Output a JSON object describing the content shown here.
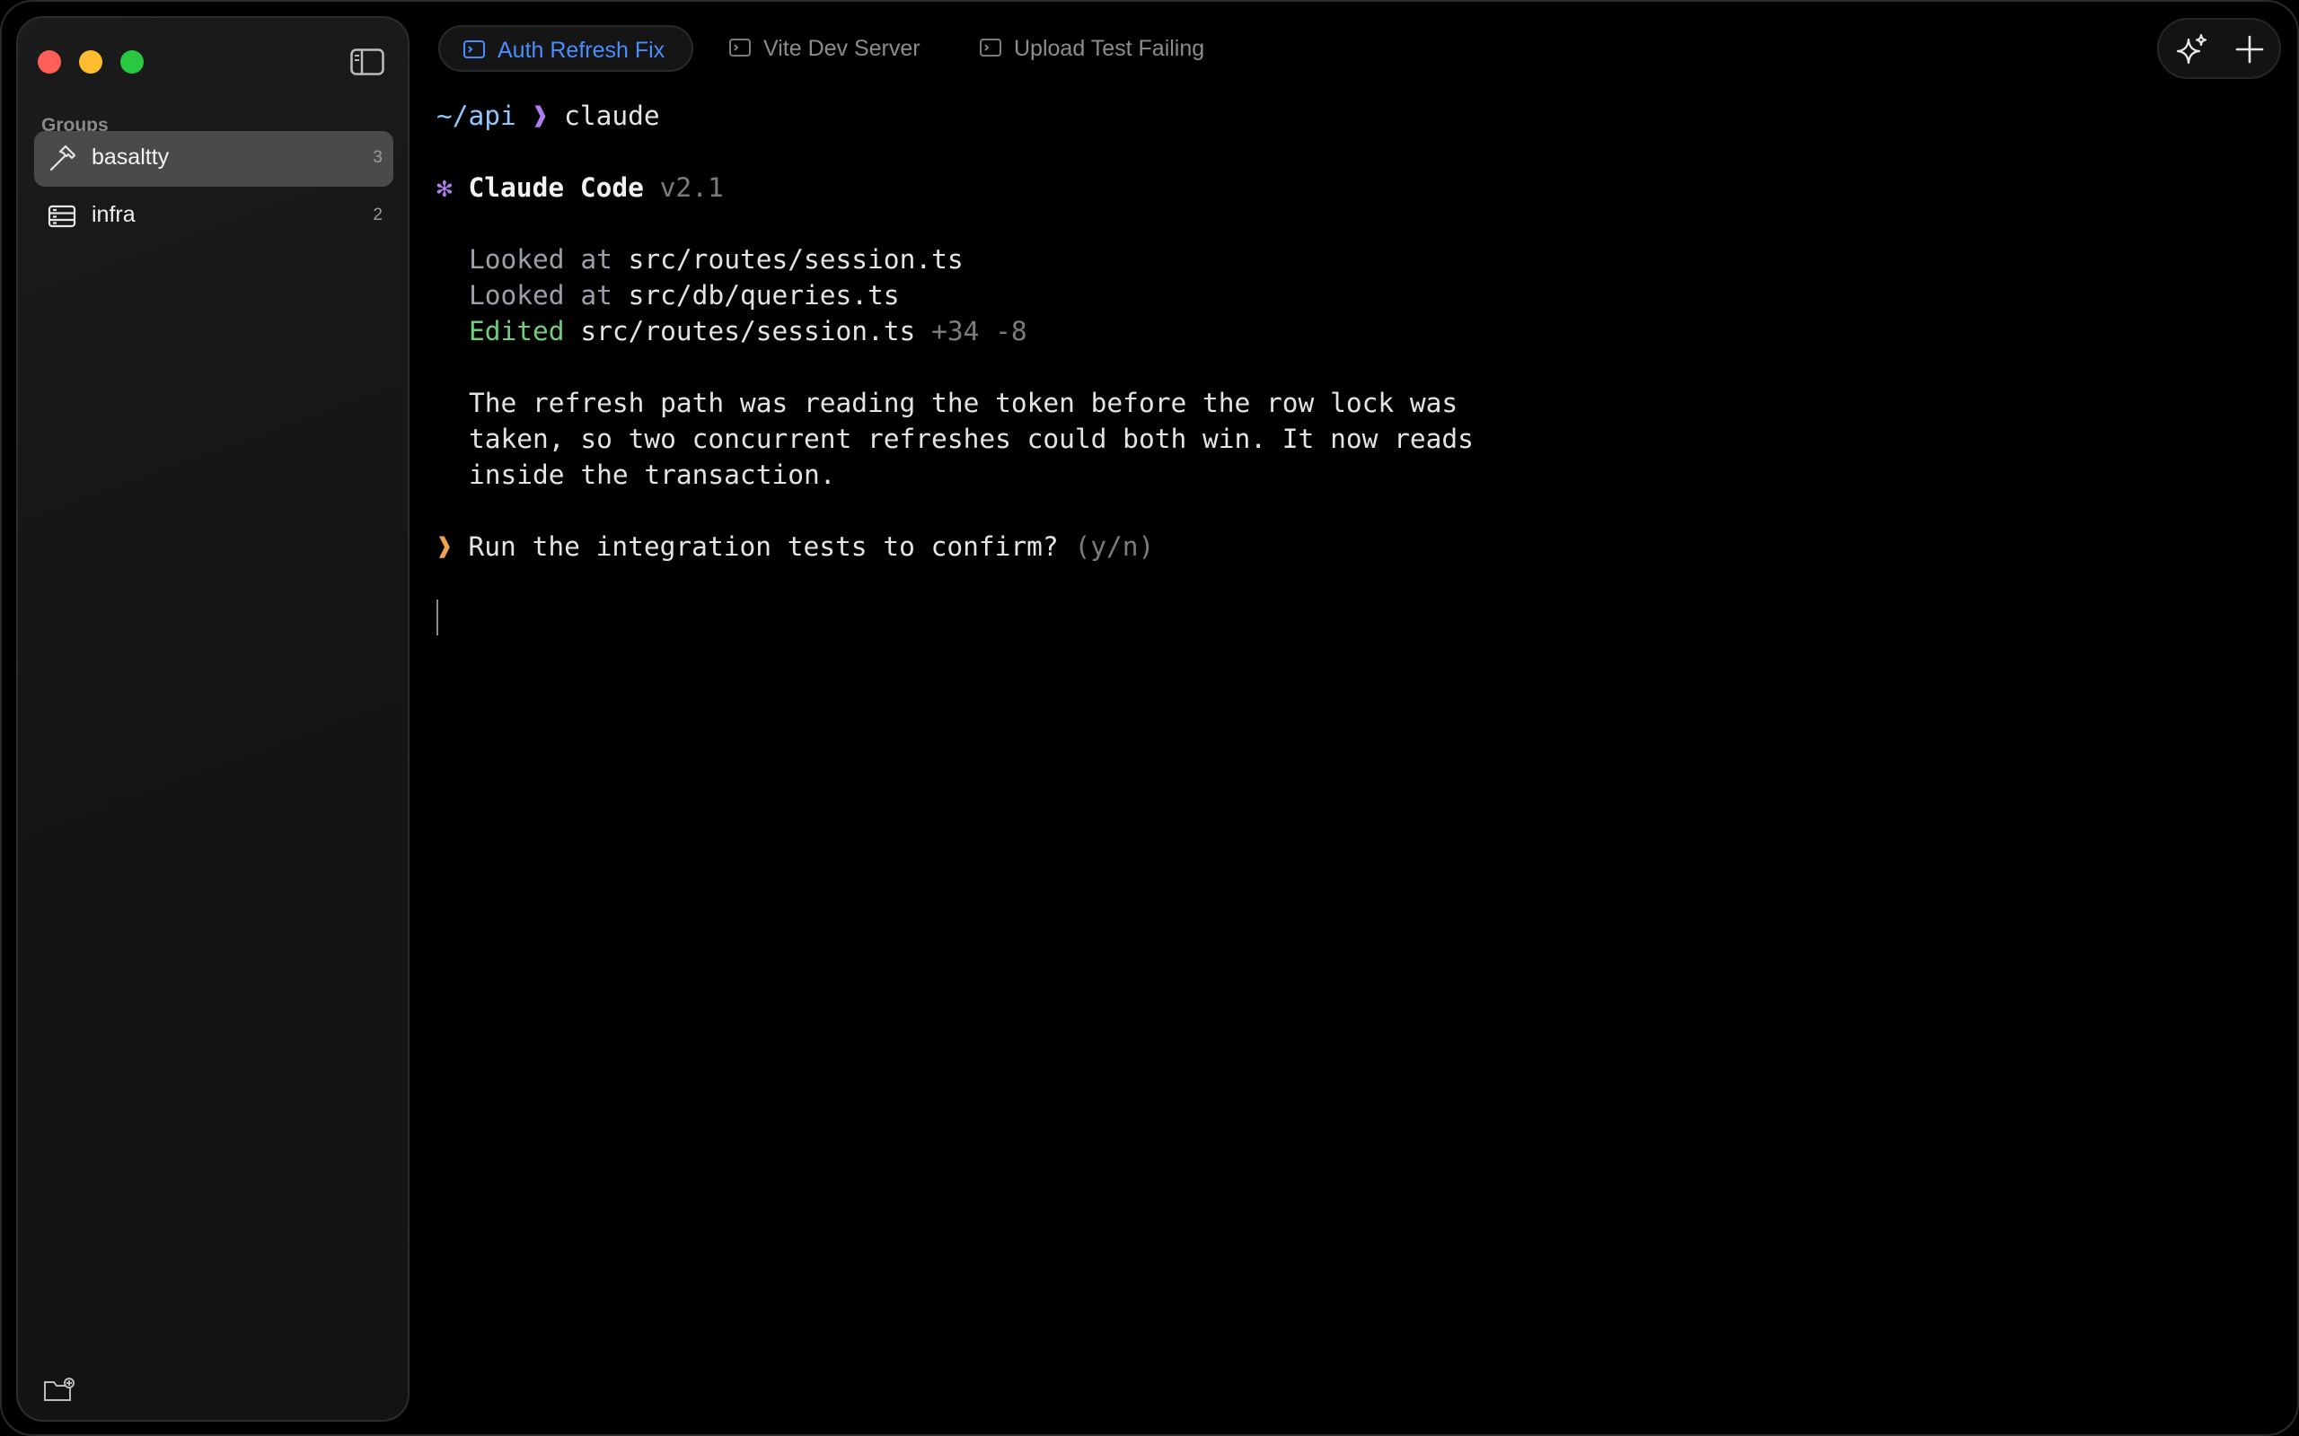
{
  "sidebar": {
    "groups_label": "Groups",
    "groups": [
      {
        "name": "basaltty",
        "count": "3",
        "icon": "hammer-icon",
        "active": true
      },
      {
        "name": "infra",
        "count": "2",
        "icon": "server-icon",
        "active": false
      }
    ]
  },
  "tabs": [
    {
      "label": "Auth Refresh Fix",
      "icon": "terminal-icon",
      "active": true
    },
    {
      "label": "Vite Dev Server",
      "icon": "terminal-icon",
      "active": false
    },
    {
      "label": "Upload Test Failing",
      "icon": "terminal-icon",
      "active": false
    }
  ],
  "terminal": {
    "prompt_path": "~/api",
    "prompt_symbol": "❱",
    "command": "claude",
    "app_star": "✻",
    "app_name": "Claude Code",
    "app_version": "v2.1",
    "actions": [
      {
        "verb": "Looked",
        "prep": "at",
        "file": "src/routes/session.ts",
        "delta": ""
      },
      {
        "verb": "Looked",
        "prep": "at",
        "file": "src/db/queries.ts",
        "delta": ""
      },
      {
        "verb": "Edited",
        "prep": "",
        "file": "src/routes/session.ts",
        "delta": "+34 -8"
      }
    ],
    "message_lines": [
      "The refresh path was reading the token before the row lock was",
      "taken, so two concurrent refreshes could both win. It now reads",
      "inside the transaction."
    ],
    "question_symbol": "❱",
    "question": "Run the integration tests to confirm?",
    "question_hint": "(y/n)"
  },
  "colors": {
    "accent_blue": "#4a8dff",
    "path_blue": "#8fc7ff",
    "prompt_purple": "#b07ef0",
    "question_orange": "#f0a24e",
    "edited_green": "#6fcf7a"
  }
}
